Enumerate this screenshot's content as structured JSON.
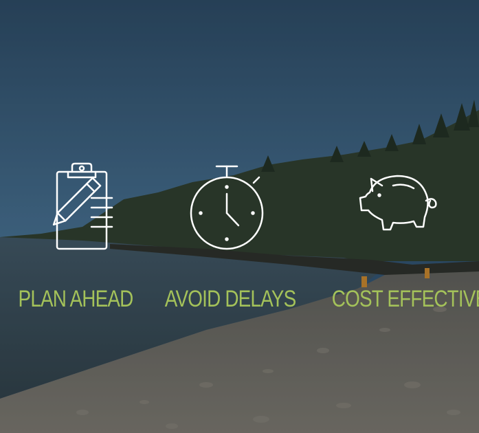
{
  "colors": {
    "label_color": "#a4c25a",
    "icon_color": "#ffffff",
    "sky_top": "#2c4a66",
    "sky_bottom": "#3d6a8f",
    "water": "#3a4e5c",
    "beach": "#6e6a62",
    "forest": "#263524"
  },
  "features": [
    {
      "label": "PLAN AHEAD",
      "icon": "clipboard-pencil-icon"
    },
    {
      "label": "AVOID DELAYS",
      "icon": "stopwatch-icon"
    },
    {
      "label": "COST EFFECTIVE",
      "icon": "piggy-bank-icon"
    }
  ]
}
